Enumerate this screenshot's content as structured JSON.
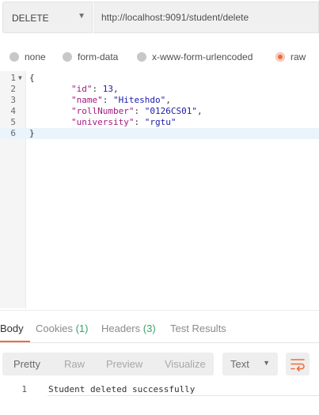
{
  "request": {
    "method": "DELETE",
    "url": "http://localhost:9091/student/delete"
  },
  "body_types": [
    {
      "label": "none",
      "selected": false
    },
    {
      "label": "form-data",
      "selected": false
    },
    {
      "label": "x-www-form-urlencoded",
      "selected": false
    },
    {
      "label": "raw",
      "selected": true
    }
  ],
  "editor": {
    "line_numbers": [
      "1",
      "2",
      "3",
      "4",
      "5",
      "6"
    ],
    "lines": [
      {
        "open_brace": "{"
      },
      {
        "key": "\"id\"",
        "sep": ": ",
        "value": "13",
        "tail": ","
      },
      {
        "key": "\"name\"",
        "sep": ": ",
        "value": "\"Hiteshdo\"",
        "tail": ","
      },
      {
        "key": "\"rollNumber\"",
        "sep": ": ",
        "value": "\"0126CS01\"",
        "tail": ","
      },
      {
        "key": "\"university\"",
        "sep": ": ",
        "value": "\"rgtu\"",
        "tail": ""
      },
      {
        "close_brace": "}"
      }
    ],
    "active_line": 6
  },
  "response_tabs": {
    "body": "Body",
    "cookies": "Cookies",
    "cookies_count": "(1)",
    "headers": "Headers",
    "headers_count": "(3)",
    "test_results": "Test Results"
  },
  "view_modes": [
    "Pretty",
    "Raw",
    "Preview",
    "Visualize"
  ],
  "active_view": "Pretty",
  "format": "Text",
  "response": {
    "line_number": "1",
    "text": "Student deleted successfully"
  },
  "colors": {
    "accent": "#f26b3a",
    "count_green": "#3aa36b",
    "json_key": "#a3187f",
    "json_value": "#1a1aa6"
  },
  "icons": {
    "method_caret": "chevron-down-icon",
    "fold_marker": "fold-arrow-icon",
    "format_caret": "chevron-down-icon",
    "wrap": "word-wrap-icon"
  }
}
